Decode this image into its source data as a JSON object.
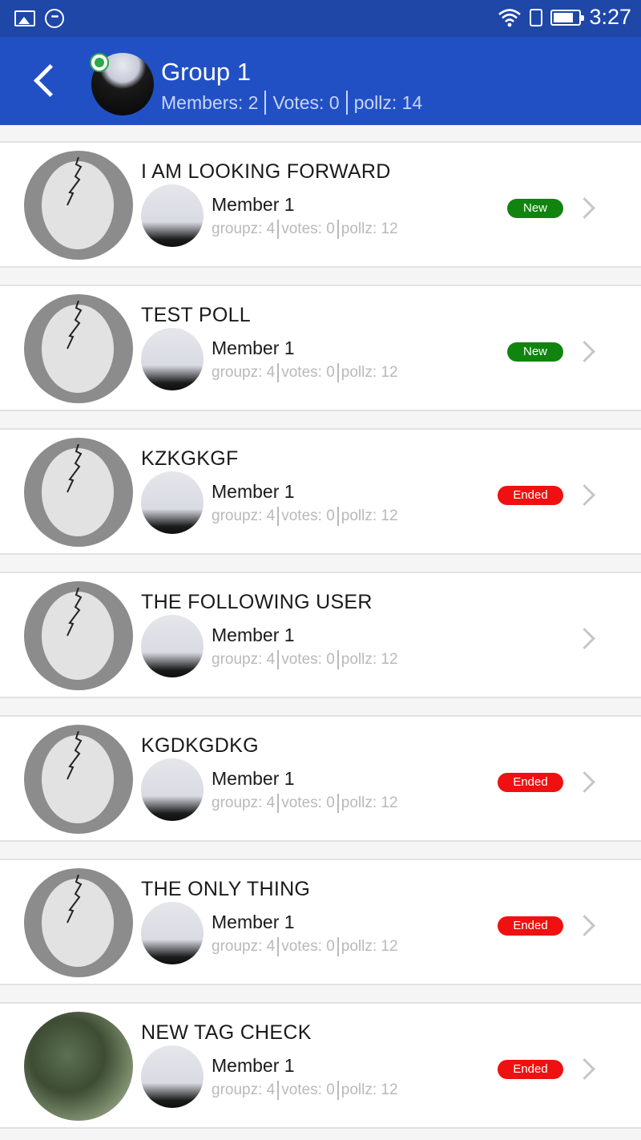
{
  "status_bar": {
    "time": "3:27",
    "icons": [
      "image-icon",
      "more-circle-icon",
      "wifi-icon",
      "sim-icon",
      "battery-icon"
    ]
  },
  "header": {
    "title": "Group 1",
    "members": "Members: 2",
    "votes": "Votes: 0",
    "pollz": "pollz: 14",
    "color": "#2150c5"
  },
  "polls": [
    {
      "title": "I AM LOOKING FORWARD",
      "member": "Member 1",
      "groupz": "groupz: 4",
      "votes": "votes: 0",
      "pollz": "pollz: 12",
      "status": "New",
      "avatar": "egg"
    },
    {
      "title": "TEST POLL",
      "member": "Member 1",
      "groupz": "groupz: 4",
      "votes": "votes: 0",
      "pollz": "pollz: 12",
      "status": "New",
      "avatar": "egg"
    },
    {
      "title": "KZKGKGF",
      "member": "Member 1",
      "groupz": "groupz: 4",
      "votes": "votes: 0",
      "pollz": "pollz: 12",
      "status": "Ended",
      "avatar": "egg"
    },
    {
      "title": "THE FOLLOWING USER",
      "member": "Member 1",
      "groupz": "groupz: 4",
      "votes": "votes: 0",
      "pollz": "pollz: 12",
      "status": "",
      "avatar": "egg"
    },
    {
      "title": "KGDKGDKG",
      "member": "Member 1",
      "groupz": "groupz: 4",
      "votes": "votes: 0",
      "pollz": "pollz: 12",
      "status": "Ended",
      "avatar": "egg"
    },
    {
      "title": "THE ONLY THING",
      "member": "Member 1",
      "groupz": "groupz: 4",
      "votes": "votes: 0",
      "pollz": "pollz: 12",
      "status": "Ended",
      "avatar": "egg"
    },
    {
      "title": "NEW TAG CHECK",
      "member": "Member 1",
      "groupz": "groupz: 4",
      "votes": "votes: 0",
      "pollz": "pollz: 12",
      "status": "Ended",
      "avatar": "photo"
    }
  ],
  "colors": {
    "new": "#10840f",
    "ended": "#f01010"
  }
}
